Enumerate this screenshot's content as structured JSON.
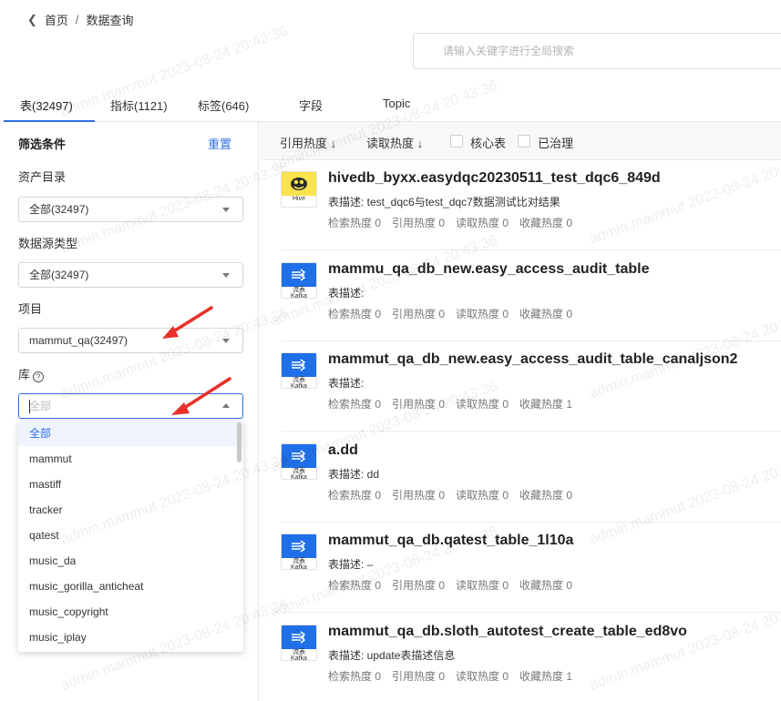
{
  "breadcrumb": {
    "home": "首页",
    "sep": "/",
    "current": "数据查询"
  },
  "search": {
    "placeholder": "请输入关键字进行全局搜索"
  },
  "tabs": [
    {
      "label": "表(32497)"
    },
    {
      "label": "指标(1121)"
    },
    {
      "label": "标签(646)"
    },
    {
      "label": "字段"
    },
    {
      "label": "Topic"
    }
  ],
  "filters": {
    "header": "筛选条件",
    "reset": "重置",
    "catalog": {
      "label": "资产目录",
      "value": "全部(32497)"
    },
    "source_type": {
      "label": "数据源类型",
      "value": "全部(32497)"
    },
    "project": {
      "label": "项目",
      "value": "mammut_qa(32497)"
    },
    "db": {
      "label": "库",
      "help": "?",
      "placeholder": "全部"
    }
  },
  "dropdown": {
    "options": [
      "全部",
      "mammut",
      "mastiff",
      "tracker",
      "qatest",
      "music_da",
      "music_gorilla_anticheat",
      "music_copyright",
      "music_iplay"
    ],
    "selected": "全部"
  },
  "sortbar": {
    "ref_hot": "引用热度 ↓",
    "read_hot": "读取热度 ↓",
    "core_table": "核心表",
    "governed": "已治理"
  },
  "results": [
    {
      "icon": "hive",
      "icon_label": "Hive",
      "title": "hivedb_byxx.easydqc20230511_test_dqc6_849d",
      "desc": "表描述: test_dqc6与test_dqc7数据测试比对结果",
      "search_hot": "检索热度 0",
      "ref_hot": "引用热度 0",
      "read_hot": "读取热度 0",
      "fav_hot": "收藏热度 0"
    },
    {
      "icon": "kafka",
      "icon_label": "流表\nKafka",
      "title": "mammu_qa_db_new.easy_access_audit_table",
      "desc": "表描述:",
      "search_hot": "检索热度 0",
      "ref_hot": "引用热度 0",
      "read_hot": "读取热度 0",
      "fav_hot": "收藏热度 0"
    },
    {
      "icon": "kafka",
      "icon_label": "流表\nKafka",
      "title": "mammut_qa_db_new.easy_access_audit_table_canaljson2",
      "desc": "表描述:",
      "search_hot": "检索热度 0",
      "ref_hot": "引用热度 0",
      "read_hot": "读取热度 0",
      "fav_hot": "收藏热度 1"
    },
    {
      "icon": "kafka",
      "icon_label": "流表\nKafka",
      "title": "a.dd",
      "desc": "表描述: dd",
      "search_hot": "检索热度 0",
      "ref_hot": "引用热度 0",
      "read_hot": "读取热度 0",
      "fav_hot": "收藏热度 0"
    },
    {
      "icon": "kafka",
      "icon_label": "流表\nKafka",
      "title": "mammut_qa_db.qatest_table_1l10a",
      "desc": "表描述: –",
      "search_hot": "检索热度 0",
      "ref_hot": "引用热度 0",
      "read_hot": "读取热度 0",
      "fav_hot": "收藏热度 0"
    },
    {
      "icon": "kafka",
      "icon_label": "流表\nKafka",
      "title": "mammut_qa_db.sloth_autotest_create_table_ed8vo",
      "desc": "表描述: update表描述信息",
      "search_hot": "检索热度 0",
      "ref_hot": "引用热度 0",
      "read_hot": "读取热度 0",
      "fav_hot": "收藏热度 1"
    }
  ],
  "watermark": "admin.mammut 2023-08-24 20:43:36",
  "colors": {
    "accent": "#2f6fe6",
    "arrow": "#e8302a",
    "hive": "#fbe34e",
    "kafka": "#1e6fe8"
  }
}
